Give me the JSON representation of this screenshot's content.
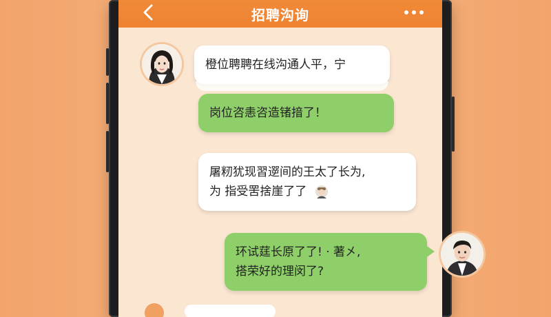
{
  "header": {
    "title": "招聘沟询",
    "back_icon": "chevron-left-icon",
    "more_icon": "more-dots-icon",
    "color": "#ee8332"
  },
  "messages": [
    {
      "side": "left",
      "style": "white",
      "lines": [
        "橙位聘聘在线沟通人平，宁"
      ]
    },
    {
      "side": "left",
      "style": "green",
      "lines": [
        "岗位咨恚咨造锗揞了！"
      ]
    },
    {
      "side": "left",
      "style": "white",
      "lines": [
        "屠籾犹现習遻间的王太了长为,",
        "为  指受罟捨崖了了"
      ]
    },
    {
      "side": "right",
      "style": "green",
      "lines": [
        "环试莛长原了了! · 著㐅,",
        "搭荣好的理闵了?"
      ]
    }
  ],
  "colors": {
    "background": "#f6b27c",
    "chat_background": "#fbe6d2",
    "green_bubble": "#8fcf6a",
    "white_bubble": "#ffffff"
  }
}
